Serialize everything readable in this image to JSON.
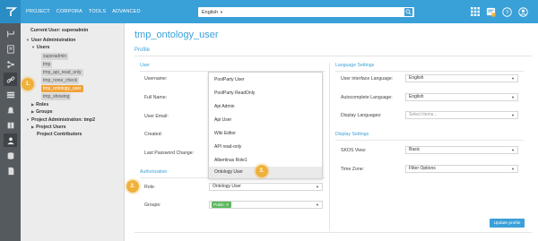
{
  "topbar": {
    "nav": [
      "PROJECT",
      "CORPORA",
      "TOOLS",
      "ADVANCED"
    ],
    "language": "English",
    "icons": [
      "grid-icon",
      "notification-icon",
      "help-icon",
      "user-icon"
    ]
  },
  "rail_icons": [
    "flow-icon",
    "docs-icon",
    "graph-icon",
    "link-icon",
    "list-icon",
    "bell-icon",
    "book-icon",
    "users-icon",
    "database-icon",
    "document-icon"
  ],
  "tree": {
    "current_user": "Current User: superadmin",
    "user_admin": "User Administration",
    "users": "Users",
    "user_items": [
      "superadmin",
      "tmp",
      "tmp_api_read_only",
      "tmp_none_check",
      "tmp_ontology_user",
      "tmp_showing"
    ],
    "roles": "Roles",
    "groups": "Groups",
    "project_admin": "Project Administration: tmp2",
    "project_users": "Project Users",
    "project_contributors": "Project Contributors"
  },
  "badges": [
    "1.",
    "2.",
    "3."
  ],
  "main": {
    "title": "tmp_ontology_user",
    "profile_tab": "Profile",
    "user_section": "User",
    "labels": {
      "username": "Username:",
      "full_name": "Full Name:",
      "email": "User Email:",
      "created": "Created:",
      "last_pw": "Last Password Change:"
    },
    "authorization": "Authorization",
    "role_label": "Role:",
    "role_value": "Ontology User",
    "groups_label": "Groups:",
    "group_tag": "Public",
    "language_settings": "Language Settings",
    "ui_lang_label": "User interface Language:",
    "ui_lang_value": "English",
    "autocomplete_label": "Autocomplete Language:",
    "autocomplete_value": "English",
    "display_label": "Display Languages:",
    "display_placeholder": "Select items...",
    "display_settings": "Display Settings",
    "skos_label": "SKOS View:",
    "skos_value": "Basic",
    "tz_label": "Time Zone:",
    "tz_value": "Filter Options",
    "update_button": "Update profile"
  },
  "role_options": [
    "PoolParty User",
    "PoolParty ReadOnly",
    "Api Admin",
    "Api User",
    "Wiki Editor",
    "API read-only",
    "Albertinas Role1",
    "Ontology User"
  ],
  "colors": {
    "accent": "#3aa0d8",
    "highlight": "#f0a33a",
    "badge": "#f0b13a",
    "tag": "#5cb85c"
  }
}
